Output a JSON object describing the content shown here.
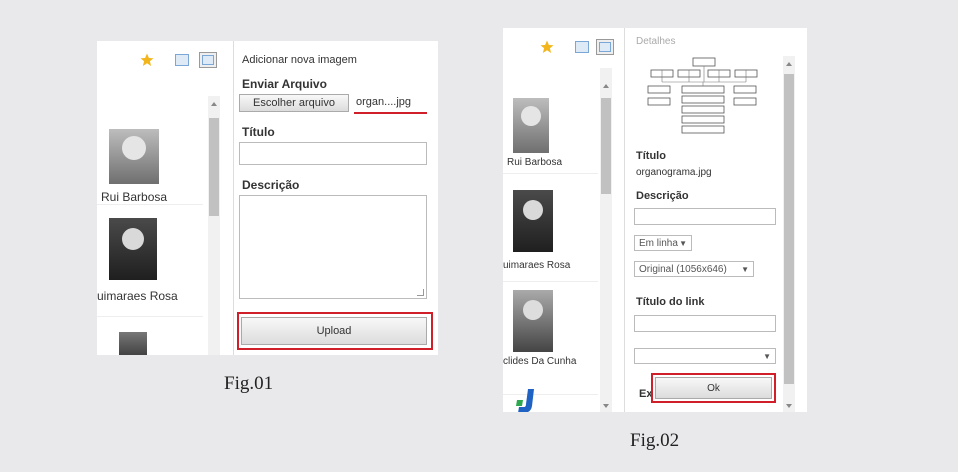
{
  "fig1": {
    "caption": "Fig.01",
    "header": "Adicionar nova imagem",
    "upload_label": "Enviar Arquivo",
    "choose_button": "Escolher arquivo",
    "file_name": "organ....jpg",
    "title_label": "Título",
    "description_label": "Descrição",
    "upload_button": "Upload",
    "people": [
      "Rui Barbosa",
      "uimaraes Rosa"
    ]
  },
  "fig2": {
    "caption": "Fig.02",
    "header": "Detalhes",
    "title_label": "Título",
    "title_value": "organograma.jpg",
    "description_label": "Descrição",
    "alignment_value": "Em linha",
    "size_value": "Original (1056x646)",
    "link_title_label": "Título do link",
    "partial_label": "Ex",
    "ok_button": "Ok",
    "people": [
      "Rui Barbosa",
      "uimaraes Rosa",
      "clides Da Cunha"
    ]
  },
  "colors": {
    "highlight": "#d11f2a",
    "star": "#f2b51b",
    "background": "#e9e9eb"
  }
}
